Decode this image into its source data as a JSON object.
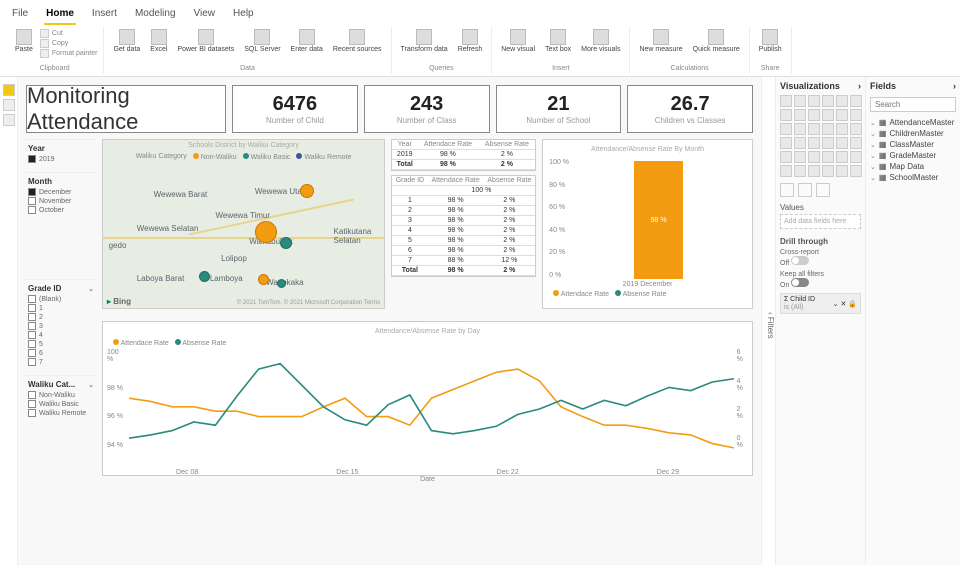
{
  "tabs": {
    "file": "File",
    "home": "Home",
    "insert": "Insert",
    "modeling": "Modeling",
    "view": "View",
    "help": "Help"
  },
  "ribbon": {
    "clipboard": {
      "paste": "Paste",
      "cut": "Cut",
      "copy": "Copy",
      "format": "Format painter",
      "label": "Clipboard"
    },
    "data": {
      "get": "Get data",
      "excel": "Excel",
      "pbi": "Power BI datasets",
      "sql": "SQL Server",
      "enter": "Enter data",
      "recent": "Recent sources",
      "label": "Data"
    },
    "queries": {
      "transform": "Transform data",
      "refresh": "Refresh",
      "label": "Queries"
    },
    "insert": {
      "new": "New visual",
      "text": "Text box",
      "more": "More visuals",
      "label": "Insert"
    },
    "calc": {
      "newm": "New measure",
      "quick": "Quick measure",
      "label": "Calculations"
    },
    "share": {
      "publish": "Publish",
      "label": "Share"
    }
  },
  "title": "Monitoring Attendance",
  "kpi": [
    {
      "v": "6476",
      "l": "Number of Child"
    },
    {
      "v": "243",
      "l": "Number of Class"
    },
    {
      "v": "21",
      "l": "Number of School"
    },
    {
      "v": "26.7",
      "l": "Children vs Classes"
    }
  ],
  "slicers": {
    "year": {
      "title": "Year",
      "items": [
        {
          "label": "2019",
          "on": true
        }
      ]
    },
    "month": {
      "title": "Month",
      "items": [
        {
          "label": "December",
          "on": true
        },
        {
          "label": "November",
          "on": false
        },
        {
          "label": "October",
          "on": false
        }
      ]
    },
    "grade": {
      "title": "Grade ID",
      "items": [
        {
          "label": "(Blank)"
        },
        {
          "label": "1"
        },
        {
          "label": "2"
        },
        {
          "label": "3"
        },
        {
          "label": "4"
        },
        {
          "label": "5"
        },
        {
          "label": "6"
        },
        {
          "label": "7"
        }
      ]
    },
    "waliku": {
      "title": "Waliku Cat...",
      "items": [
        {
          "label": "Non-Waliku"
        },
        {
          "label": "Waliku Basic"
        },
        {
          "label": "Waliku Remote"
        }
      ]
    }
  },
  "map": {
    "title": "Schools District by Waliku Category",
    "legend": {
      "cat": "Waliku Category",
      "a": "Non-Waliku",
      "b": "Waliku Basic",
      "c": "Waliku Remote"
    },
    "labels": [
      "Wewewa Barat",
      "Wewewa Utara",
      "Wewewa Timur",
      "Wewewa Selatan",
      "Waikabubak",
      "Lolipop",
      "Laboya Barat",
      "Lamboya",
      "Wanokaka",
      "gedo",
      "Katikutana Selatan"
    ],
    "bing": "Bing",
    "attr": "© 2021 TomTom, © 2021 Microsoft Corporation Terms"
  },
  "yearTable": {
    "cols": [
      "Year",
      "Attendace Rate",
      "Absense Rate"
    ],
    "rows": [
      [
        "2019",
        "98 %",
        "2 %"
      ]
    ],
    "total": [
      "Total",
      "98 %",
      "2 %"
    ]
  },
  "gradeTable": {
    "cols": [
      "Grade ID",
      "Attendace Rate",
      "Absense Rate"
    ],
    "head2": "100 %",
    "rows": [
      [
        "1",
        "98 %",
        "2 %"
      ],
      [
        "2",
        "98 %",
        "2 %"
      ],
      [
        "3",
        "98 %",
        "2 %"
      ],
      [
        "4",
        "98 %",
        "2 %"
      ],
      [
        "5",
        "98 %",
        "2 %"
      ],
      [
        "6",
        "98 %",
        "2 %"
      ],
      [
        "7",
        "88 %",
        "12 %"
      ]
    ],
    "total": [
      "Total",
      "98 %",
      "2 %"
    ]
  },
  "bar": {
    "title": "Attendance/Absense Rate By Month",
    "legend": {
      "a": "Attendace Rate",
      "b": "Absense Rate"
    },
    "yticks": [
      "100 %",
      "80 %",
      "60 %",
      "40 %",
      "20 %",
      "0 %"
    ],
    "value": "98 %",
    "xlabel": "2019 December"
  },
  "line": {
    "title": "Attendance/Absense Rate by Day",
    "legend": {
      "a": "Attendace Rate",
      "b": "Absense Rate"
    },
    "ylticks": [
      "100 %",
      "98 %",
      "96 %",
      "94 %"
    ],
    "yrticks": [
      "6 %",
      "4 %",
      "2 %",
      "0 %"
    ],
    "xticks": [
      "Dec 08",
      "Dec 15",
      "Dec 22",
      "Dec 29"
    ],
    "xlabel": "Date"
  },
  "filtersFlag": "Filters",
  "vispane": {
    "title": "Visualizations",
    "values": "Values",
    "well": "Add data fields here",
    "drill": "Drill through",
    "cross": "Cross-report",
    "off": "Off",
    "keep": "Keep all filters",
    "on": "On",
    "chip": {
      "name": "Child ID",
      "sub": "is (All)"
    }
  },
  "fieldspane": {
    "title": "Fields",
    "search": "Search",
    "tables": [
      "AttendanceMaster",
      "ChildrenMaster",
      "ClassMaster",
      "GradeMaster",
      "Map Data",
      "SchoolMaster"
    ]
  },
  "chart_data": [
    {
      "type": "table",
      "title": "KPI cards",
      "categories": [
        "Number of Child",
        "Number of Class",
        "Number of School",
        "Children vs Classes"
      ],
      "values": [
        6476,
        243,
        21,
        26.7
      ]
    },
    {
      "type": "table",
      "title": "Year Attendance",
      "columns": [
        "Year",
        "Attendace Rate",
        "Absense Rate"
      ],
      "rows": [
        [
          "2019",
          0.98,
          0.02
        ]
      ],
      "total": [
        "Total",
        0.98,
        0.02
      ]
    },
    {
      "type": "table",
      "title": "Grade Attendance",
      "columns": [
        "Grade ID",
        "Attendace Rate",
        "Absense Rate"
      ],
      "rows": [
        [
          "1",
          0.98,
          0.02
        ],
        [
          "2",
          0.98,
          0.02
        ],
        [
          "3",
          0.98,
          0.02
        ],
        [
          "4",
          0.98,
          0.02
        ],
        [
          "5",
          0.98,
          0.02
        ],
        [
          "6",
          0.98,
          0.02
        ],
        [
          "7",
          0.88,
          0.12
        ]
      ],
      "total": [
        "Total",
        0.98,
        0.02
      ]
    },
    {
      "type": "bar",
      "title": "Attendance/Absense Rate By Month",
      "categories": [
        "2019 December"
      ],
      "series": [
        {
          "name": "Attendace Rate",
          "values": [
            0.98
          ]
        },
        {
          "name": "Absense Rate",
          "values": [
            0.02
          ]
        }
      ],
      "ylim": [
        0,
        1
      ]
    },
    {
      "type": "line",
      "title": "Attendance/Absense Rate by Day",
      "xlabel": "Date",
      "x": [
        "Dec 02",
        "Dec 03",
        "Dec 04",
        "Dec 05",
        "Dec 06",
        "Dec 07",
        "Dec 08",
        "Dec 09",
        "Dec 10",
        "Dec 11",
        "Dec 12",
        "Dec 13",
        "Dec 14",
        "Dec 15",
        "Dec 16",
        "Dec 17",
        "Dec 18",
        "Dec 19",
        "Dec 20",
        "Dec 21",
        "Dec 22",
        "Dec 23",
        "Dec 24",
        "Dec 25",
        "Dec 26",
        "Dec 27",
        "Dec 28",
        "Dec 29",
        "Dec 30"
      ],
      "series": [
        {
          "name": "Attendace Rate",
          "axis": "left",
          "values": [
            0.975,
            0.973,
            0.97,
            0.97,
            0.968,
            0.968,
            0.965,
            0.965,
            0.965,
            0.97,
            0.975,
            0.965,
            0.965,
            0.96,
            0.975,
            0.98,
            0.985,
            0.99,
            0.992,
            0.985,
            0.97,
            0.965,
            0.96,
            0.96,
            0.958,
            0.956,
            0.955,
            0.95,
            0.948
          ]
        },
        {
          "name": "Absense Rate",
          "axis": "right",
          "values": [
            0.015,
            0.017,
            0.02,
            0.025,
            0.023,
            0.04,
            0.055,
            0.058,
            0.045,
            0.032,
            0.025,
            0.022,
            0.034,
            0.04,
            0.02,
            0.018,
            0.02,
            0.022,
            0.03,
            0.033,
            0.038,
            0.033,
            0.038,
            0.035,
            0.04,
            0.045,
            0.043,
            0.048,
            0.05
          ]
        }
      ],
      "yl_lim": [
        0.94,
        1.0
      ],
      "yr_lim": [
        0,
        0.06
      ]
    }
  ]
}
